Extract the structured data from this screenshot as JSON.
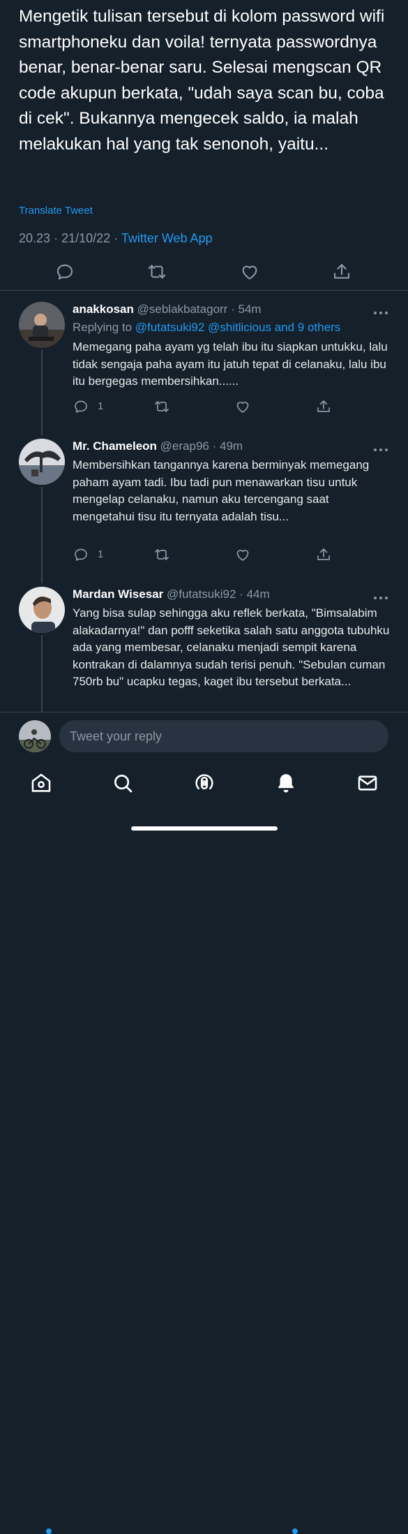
{
  "tweet": {
    "text": "Mengetik tulisan tersebut di kolom password wifi smartphoneku dan voila! ternyata passwordnya benar, benar-benar saru. Selesai mengscan QR code akupun berkata, \"udah saya scan bu, coba di cek\". Bukannya mengecek saldo, ia malah melakukan hal yang tak senonoh, yaitu...",
    "translate_label": "Translate Tweet",
    "time": "20.23",
    "date": "21/10/22",
    "separator": "·",
    "source_app": "Twitter Web App"
  },
  "actions": {
    "reply_icon": "reply-icon",
    "retweet_icon": "retweet-icon",
    "like_icon": "like-icon",
    "share_icon": "share-icon"
  },
  "replies": [
    {
      "name": "anakkosan",
      "handle": "@seblakbatagorr",
      "separator": "·",
      "time": "54m",
      "replying_label": "Replying to",
      "replying_users": "@futatsuki92 @shitlicious",
      "replying_and": "and",
      "replying_others": "9 others",
      "text": "Memegang paha ayam yg telah ibu itu siapkan untukku, lalu tidak sengaja paha ayam itu jatuh tepat di celanaku, lalu ibu itu bergegas membersihkan......",
      "reply_count": "1"
    },
    {
      "name": "Mr. Chameleon",
      "handle": "@erap96",
      "separator": "·",
      "time": "49m",
      "text": "Membersihkan tangannya karena berminyak memegang paham ayam tadi. Ibu tadi pun menawarkan tisu untuk mengelap celanaku, namun aku tercengang saat mengetahui tisu itu ternyata adalah tisu...",
      "reply_count": "1"
    },
    {
      "name": "Mardan Wisesar",
      "handle": "@futatsuki92",
      "separator": "·",
      "time": "44m",
      "text": "Yang bisa sulap sehingga aku reflek berkata, \"Bimsalabim alakadarnya!\" dan pofff seketika salah satu anggota tubuhku ada yang membesar, celanaku menjadi sempit karena kontrakan di dalamnya sudah terisi penuh. \"Sebulan cuman 750rb bu\" ucapku tegas, kaget ibu tersebut berkata..."
    }
  ],
  "compose": {
    "placeholder": "Tweet your reply"
  },
  "tabbar": {
    "items": [
      "home-icon",
      "search-icon",
      "spaces-icon",
      "notifications-icon",
      "messages-icon"
    ]
  },
  "colors": {
    "background": "#15202b",
    "accent": "#1d9bf0",
    "muted": "#8b98a5",
    "divider": "#38444d"
  }
}
